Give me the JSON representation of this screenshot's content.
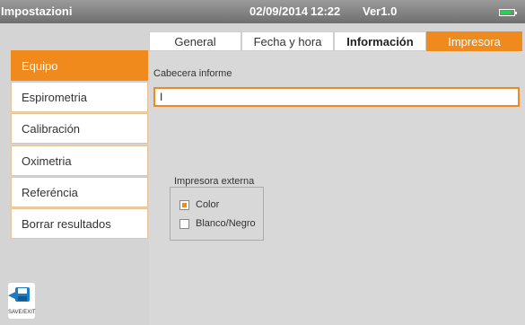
{
  "status_bar": {
    "app_title": "Impostazioni",
    "date": "02/09/2014",
    "time": "12:22",
    "version": "Ver1.0",
    "battery_icon": "battery-icon"
  },
  "tabs": [
    {
      "label": "General",
      "state": "normal"
    },
    {
      "label": "Fecha y hora",
      "state": "normal"
    },
    {
      "label": "Información",
      "state": "bold"
    },
    {
      "label": "Impresora",
      "state": "active"
    }
  ],
  "sidebar": {
    "items": [
      {
        "label": "Equipo",
        "active": true
      },
      {
        "label": "Espirometria",
        "active": false
      },
      {
        "label": "Calibración",
        "active": false
      },
      {
        "label": "Oximetria",
        "active": false
      },
      {
        "label": "Referéncia",
        "active": false
      },
      {
        "label": "Borrar resultados",
        "active": false
      }
    ]
  },
  "content": {
    "header_label": "Cabecera informe",
    "header_value": "I",
    "printer_group": {
      "title": "Impresora externa",
      "options": [
        {
          "label": "Color",
          "checked": true
        },
        {
          "label": "Blanco/Negro",
          "checked": false
        }
      ]
    }
  },
  "save_exit": {
    "label": "SAVE/EXIT",
    "icon": "floppy-disk-icon"
  },
  "colors": {
    "accent": "#f08a1c",
    "background": "#d4d4d4"
  }
}
